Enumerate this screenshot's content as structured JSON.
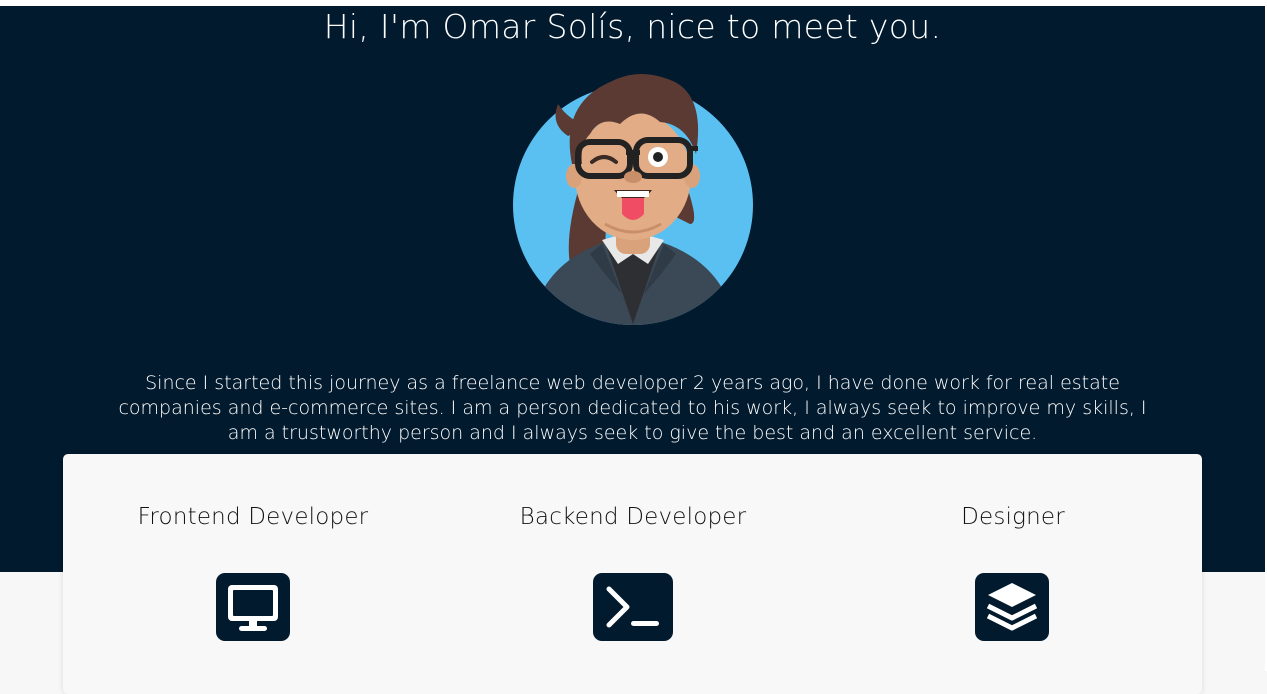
{
  "hero": {
    "greeting": "Hi, I'm Omar Solís, nice to meet you.",
    "bio": "Since I started this journey as a freelance web developer 2 years ago, I have done work for real estate companies and e-commerce sites. I am a person dedicated to his work, I always seek to improve my skills, I am a trustworthy person and I always seek to give the best and an excellent service."
  },
  "skills": [
    {
      "title": "Frontend Developer",
      "icon": "monitor-icon"
    },
    {
      "title": "Backend Developer",
      "icon": "terminal-icon"
    },
    {
      "title": "Designer",
      "icon": "layers-icon"
    }
  ],
  "colors": {
    "hero_bg": "#011a2e",
    "avatar_bg": "#5ac0f2",
    "card_bg": "#f8f8f8",
    "icon_tile": "#011a2e"
  }
}
